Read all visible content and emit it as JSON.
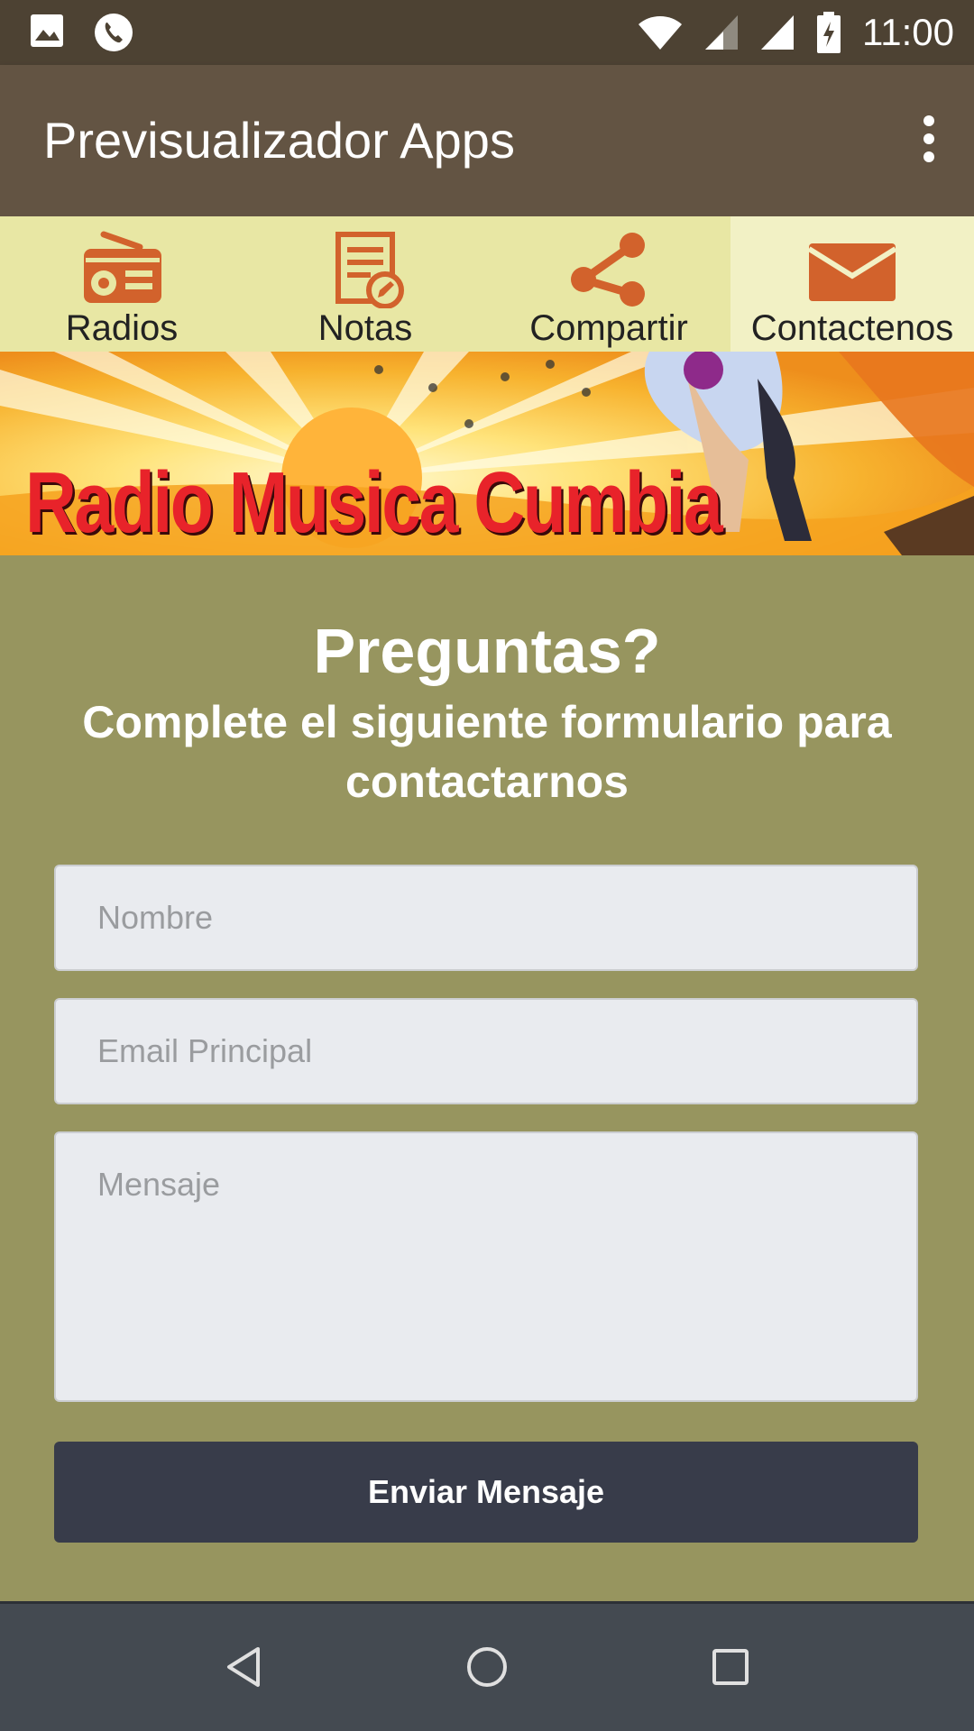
{
  "status_bar": {
    "time": "11:00",
    "icons": [
      "image-icon",
      "phone-icon",
      "wifi-icon",
      "signal-icon",
      "signal-icon",
      "battery-charging-icon"
    ]
  },
  "toolbar": {
    "title": "Previsualizador Apps",
    "menu_icon": "more-vert-icon"
  },
  "tabs": [
    {
      "label": "Radios",
      "icon": "radio-icon",
      "active": false
    },
    {
      "label": "Notas",
      "icon": "notes-icon",
      "active": false
    },
    {
      "label": "Compartir",
      "icon": "share-icon",
      "active": false
    },
    {
      "label": "Contactenos",
      "icon": "mail-icon",
      "active": true
    }
  ],
  "banner": {
    "text": "Radio Musica Cumbia"
  },
  "form": {
    "heading": "Preguntas?",
    "subheading": "Complete el siguiente formulario para contactarnos",
    "name_placeholder": "Nombre",
    "email_placeholder": "Email Principal",
    "message_placeholder": "Mensaje",
    "submit_label": "Enviar Mensaje"
  },
  "nav_bar": {
    "buttons": [
      "back-icon",
      "home-icon",
      "recents-icon"
    ]
  },
  "colors": {
    "status_bar": "#4D4233",
    "toolbar": "#635443",
    "tabs_bg": "#E8E7A4",
    "tab_active_bg": "#F2F1C5",
    "icon_orange": "#D2622C",
    "content_bg": "#97955F",
    "button_bg": "#383C4A",
    "nav_bar": "#444A51"
  }
}
